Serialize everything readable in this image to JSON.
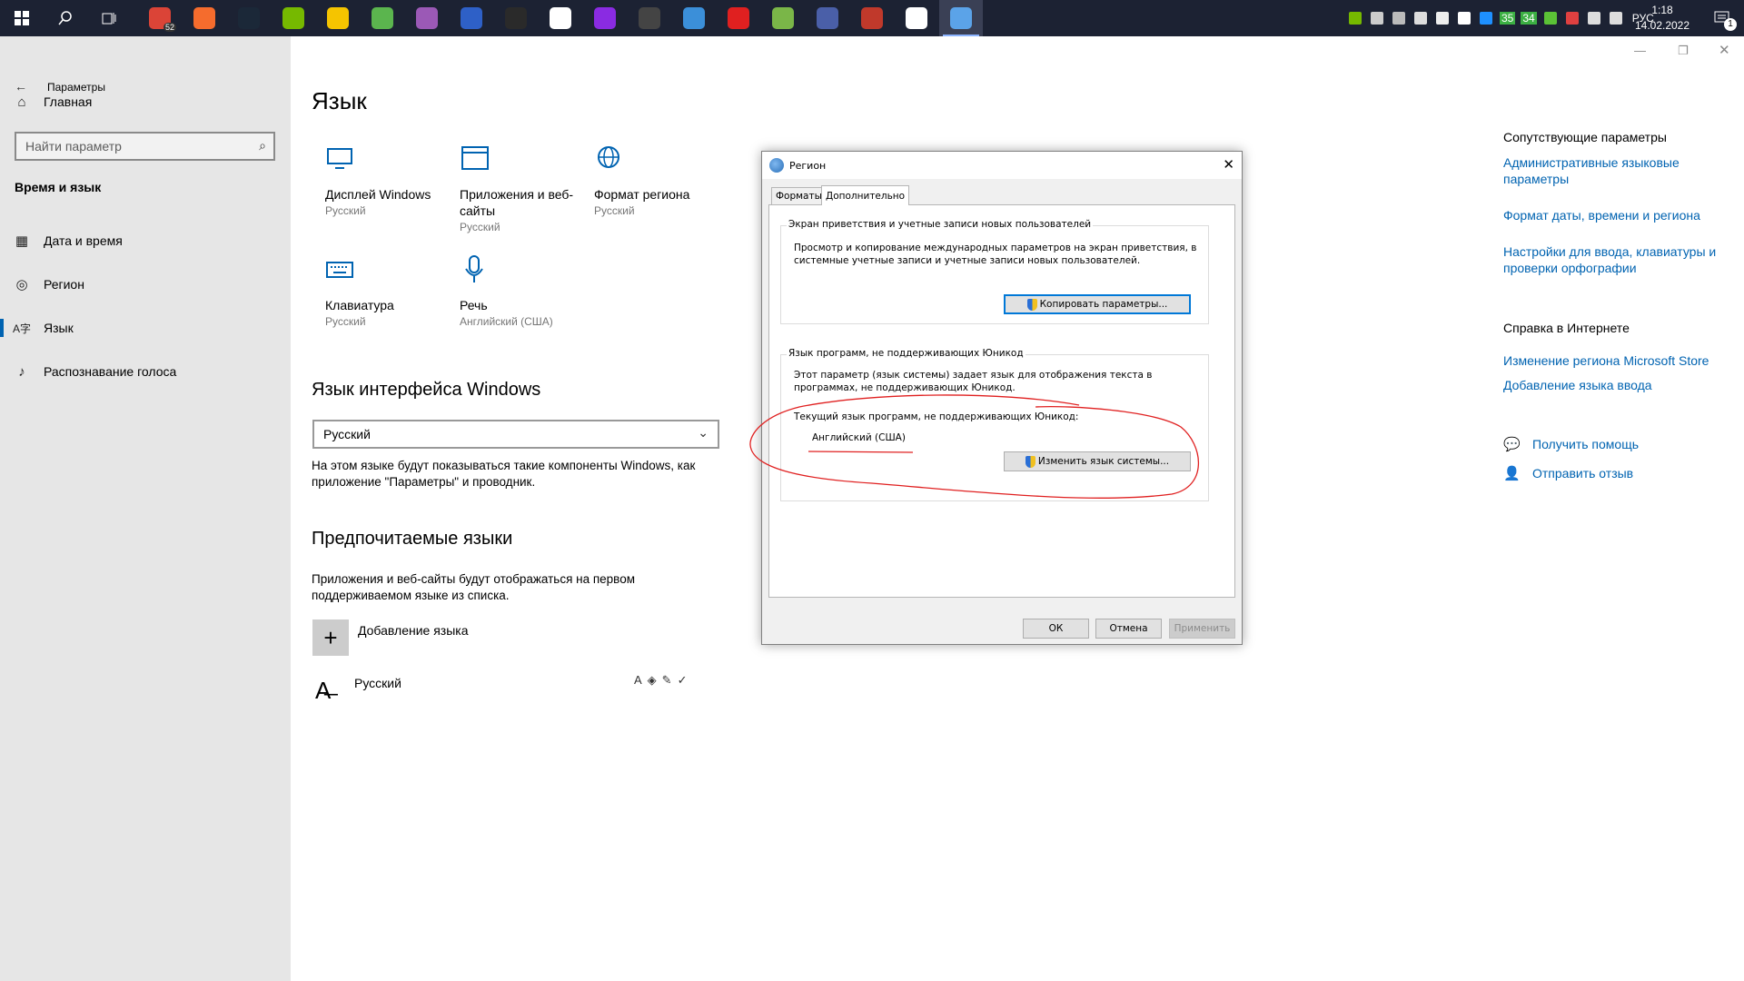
{
  "taskbar": {
    "apps": [
      {
        "name": "start-icon",
        "color": "#ffffff"
      },
      {
        "name": "search-icon",
        "color": "#ffffff"
      },
      {
        "name": "task-view-icon",
        "color": "#ffffff"
      },
      {
        "name": "chrome-icon",
        "color": "#db4437",
        "badge": "52"
      },
      {
        "name": "origin-icon",
        "color": "#f56c2d"
      },
      {
        "name": "steam-icon",
        "color": "#1b2838"
      },
      {
        "name": "nvidia-icon",
        "color": "#76b900"
      },
      {
        "name": "v-app-icon",
        "color": "#f5c400"
      },
      {
        "name": "map-app-icon",
        "color": "#5bb54e"
      },
      {
        "name": "cat-app-icon",
        "color": "#9b59b6"
      },
      {
        "name": "yellow-app-icon",
        "color": "#2e60c7"
      },
      {
        "name": "epic-games-icon",
        "color": "#2a2a2a"
      },
      {
        "name": "gamepad-icon",
        "color": "#ffffff"
      },
      {
        "name": "circle-app-icon",
        "color": "#8a2be2"
      },
      {
        "name": "game-figure-icon",
        "color": "#444444"
      },
      {
        "name": "blue-app-icon",
        "color": "#3b8fd9"
      },
      {
        "name": "m-app-icon",
        "color": "#e02020"
      },
      {
        "name": "notepad-app-icon",
        "color": "#7ab648"
      },
      {
        "name": "avatar-app-icon",
        "color": "#4a5fa8"
      },
      {
        "name": "red-app-icon",
        "color": "#c0392b"
      },
      {
        "name": "settings-app-icon",
        "color": "#ffffff"
      },
      {
        "name": "region-app-icon",
        "color": "#5ba3e8"
      }
    ],
    "tray": {
      "indicator_a": "35",
      "indicator_b": "34",
      "lang": "РУС",
      "time": "1:18",
      "date": "14.02.2022",
      "notification_count": "1"
    }
  },
  "settings": {
    "window_title": "Параметры",
    "home": "Главная",
    "search_placeholder": "Найти параметр",
    "section": "Время и язык",
    "nav": [
      {
        "label": "Дата и время",
        "icon": "calendar-clock-icon",
        "glyph": "▦"
      },
      {
        "label": "Регион",
        "icon": "globe-icon",
        "glyph": "◎"
      },
      {
        "label": "Язык",
        "icon": "language-icon",
        "glyph": "A字"
      },
      {
        "label": "Распознавание голоса",
        "icon": "microphone-icon",
        "glyph": "🎙"
      }
    ],
    "page_title": "Язык",
    "tiles": [
      {
        "name": "Дисплей Windows",
        "sub": "Русский",
        "icon": "monitor-icon"
      },
      {
        "name": "Приложения и веб-сайты",
        "sub": "Русский",
        "icon": "app-window-icon"
      },
      {
        "name": "Формат региона",
        "sub": "Русский",
        "icon": "region-format-icon"
      },
      {
        "name": "Клавиатура",
        "sub": "Русский",
        "icon": "keyboard-icon"
      },
      {
        "name": "Речь",
        "sub": "Английский (США)",
        "icon": "microphone-icon"
      }
    ],
    "ui_lang_heading": "Язык интерфейса Windows",
    "ui_lang_value": "Русский",
    "ui_lang_desc": "На этом языке будут показываться такие компоненты Windows, как приложение \"Параметры\" и проводник.",
    "pref_heading": "Предпочитаемые языки",
    "pref_desc": "Приложения и веб-сайты будут отображаться на первом поддерживаемом языке из списка.",
    "add_lang": "Добавление языка",
    "pref_lang_item": "Русский",
    "related": {
      "heading": "Сопутствующие параметры",
      "links": [
        "Административные языковые параметры",
        "Формат даты, времени и региона",
        "Настройки для ввода, клавиатуры и проверки орфографии"
      ]
    },
    "web_help": {
      "heading": "Справка в Интернете",
      "links": [
        "Изменение региона Microsoft Store",
        "Добавление языка ввода"
      ]
    },
    "get_help": "Получить помощь",
    "feedback": "Отправить отзыв"
  },
  "dialog": {
    "title": "Регион",
    "tabs": [
      "Форматы",
      "Дополнительно"
    ],
    "group1": {
      "label": "Экран приветствия и учетные записи новых пользователей",
      "text": "Просмотр и копирование международных параметров на экран приветствия, в системные учетные записи и учетные записи новых пользователей.",
      "button": "Копировать параметры..."
    },
    "group2": {
      "label": "Язык программ, не поддерживающих Юникод",
      "text": "Этот параметр (язык системы) задает язык для отображения текста в программах, не поддерживающих Юникод.",
      "current_label": "Текущий язык программ, не поддерживающих Юникод:",
      "current_value": "Английский (США)",
      "button": "Изменить язык системы..."
    },
    "buttons": {
      "ok": "ОК",
      "cancel": "Отмена",
      "apply": "Применить"
    }
  },
  "annotation_color": "#e02020"
}
